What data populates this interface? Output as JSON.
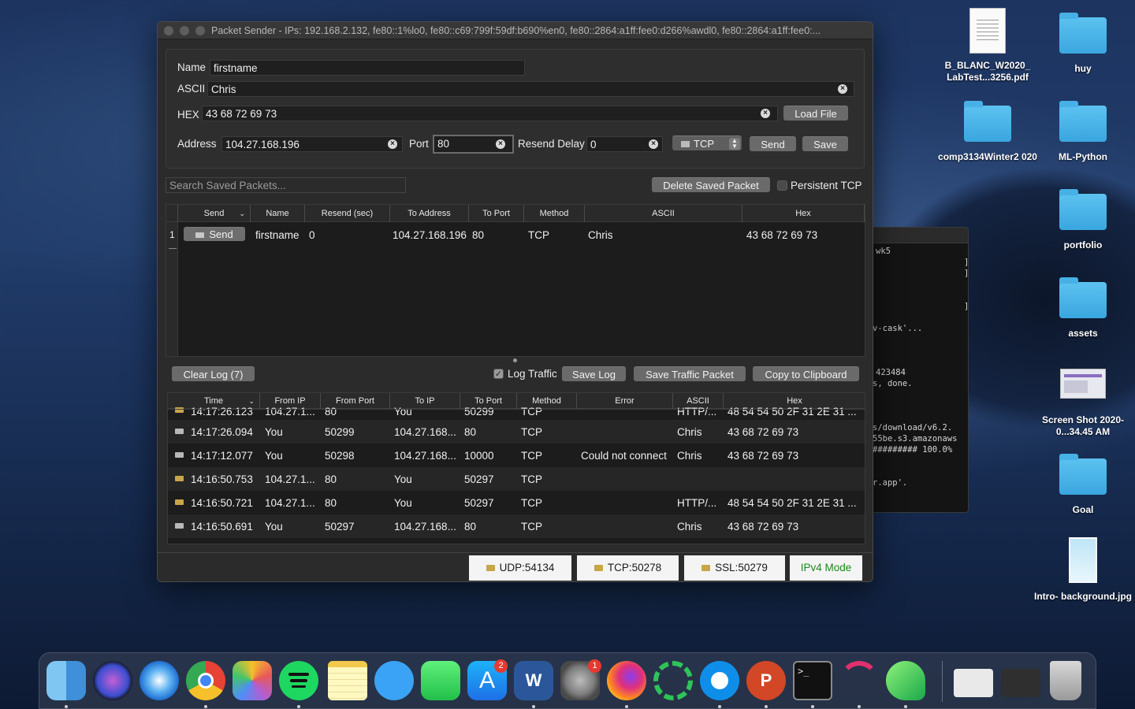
{
  "window": {
    "title": "Packet Sender - IPs: 192.168.2.132, fe80::1%lo0, fe80::c69:799f:59df:b690%en0, fe80::2864:a1ff:fee0:d266%awdl0, fe80::2864:a1ff:fee0:..."
  },
  "form": {
    "name_label": "Name",
    "name_value": "firstname",
    "ascii_label": "ASCII",
    "ascii_value": "Chris",
    "hex_label": "HEX",
    "hex_value": "43 68 72 69 73",
    "load_file": "Load File",
    "address_label": "Address",
    "address_value": "104.27.168.196",
    "port_label": "Port",
    "port_value": "80",
    "resend_label": "Resend Delay",
    "resend_value": "0",
    "protocol": "TCP",
    "send": "Send",
    "save": "Save"
  },
  "saved": {
    "search_placeholder": "Search Saved Packets...",
    "delete_button": "Delete Saved Packet",
    "persistent_tcp": "Persistent TCP",
    "columns": [
      "Send",
      "Name",
      "Resend (sec)",
      "To Address",
      "To Port",
      "Method",
      "ASCII",
      "Hex"
    ],
    "rows": [
      {
        "index": "1",
        "send": "Send",
        "name": "firstname",
        "resend": "0",
        "address": "104.27.168.196",
        "port": "80",
        "method": "TCP",
        "ascii": "Chris",
        "hex": "43 68 72 69 73"
      }
    ]
  },
  "log": {
    "clear_button": "Clear Log (7)",
    "log_traffic": "Log Traffic",
    "log_traffic_checked": true,
    "save_log": "Save Log",
    "save_traffic_packet": "Save Traffic Packet",
    "copy_clipboard": "Copy to Clipboard",
    "columns": [
      "Time",
      "From IP",
      "From Port",
      "To IP",
      "To Port",
      "Method",
      "Error",
      "ASCII",
      "Hex"
    ],
    "rows": [
      {
        "dir": "in",
        "time": "14:17:26.123",
        "from_ip": "104.27.1...",
        "from_port": "80",
        "to_ip": "You",
        "to_port": "50299",
        "method": "TCP",
        "error": "",
        "ascii": "HTTP/...",
        "hex": "48 54 54 50 2F 31 2E 31 ..."
      },
      {
        "dir": "out",
        "time": "14:17:26.094",
        "from_ip": "You",
        "from_port": "50299",
        "to_ip": "104.27.168....",
        "to_port": "80",
        "method": "TCP",
        "error": "",
        "ascii": "Chris",
        "hex": "43 68 72 69 73"
      },
      {
        "dir": "out",
        "time": "14:17:12.077",
        "from_ip": "You",
        "from_port": "50298",
        "to_ip": "104.27.168....",
        "to_port": "10000",
        "method": "TCP",
        "error": "Could not connect",
        "ascii": "Chris",
        "hex": "43 68 72 69 73"
      },
      {
        "dir": "in",
        "time": "14:16:50.753",
        "from_ip": "104.27.1...",
        "from_port": "80",
        "to_ip": "You",
        "to_port": "50297",
        "method": "TCP",
        "error": "",
        "ascii": "",
        "hex": ""
      },
      {
        "dir": "in",
        "time": "14:16:50.721",
        "from_ip": "104.27.1...",
        "from_port": "80",
        "to_ip": "You",
        "to_port": "50297",
        "method": "TCP",
        "error": "",
        "ascii": "HTTP/...",
        "hex": "48 54 54 50 2F 31 2E 31 ..."
      },
      {
        "dir": "out",
        "time": "14:16:50.691",
        "from_ip": "You",
        "from_port": "50297",
        "to_ip": "104.27.168....",
        "to_port": "80",
        "method": "TCP",
        "error": "",
        "ascii": "Chris",
        "hex": "43 68 72 69 73"
      }
    ]
  },
  "status": {
    "udp": "UDP:54134",
    "tcp": "TCP:50278",
    "ssl": "SSL:50279",
    "mode": "IPv4 Mode"
  },
  "terminal": {
    "lines": [
      "wk5",
      "]",
      "]",
      "]",
      "v-cask'...",
      "423484",
      "s, done.",
      "s/download/v6.2.",
      "55be.s3.amazonaws",
      "######### 100.0%",
      "r.app'."
    ]
  },
  "desktop": {
    "icons": [
      "B_BLANC_W2020_ LabTest...3256.pdf",
      "huy",
      "comp3134Winter2 020",
      "ML-Python",
      "portfolio",
      "assets",
      "Screen Shot 2020-0...34.45 AM",
      "Goal",
      "Intro- background.jpg"
    ]
  },
  "dock": {
    "apps": [
      "finder-icon",
      "siri-icon",
      "safari-icon",
      "chrome-icon",
      "photos-icon",
      "spotify-icon",
      "notes-icon",
      "messages-icon",
      "facetime-icon",
      "app-store-icon",
      "word-icon",
      "system-preferences-icon",
      "firefox-icon",
      "circle-app-icon",
      "teamviewer-icon",
      "powerpoint-icon",
      "terminal-icon",
      "wifi-explorer-icon",
      "packet-sender-icon",
      "recent-doc-icon",
      "recent-window-icon",
      "trash-icon"
    ],
    "app_store_badge": "2",
    "system_prefs_badge": "1"
  },
  "colors": {
    "ipv4_mode": "#1a8a1a",
    "button": "#6a6a6a",
    "accent": "#3aa6df"
  }
}
